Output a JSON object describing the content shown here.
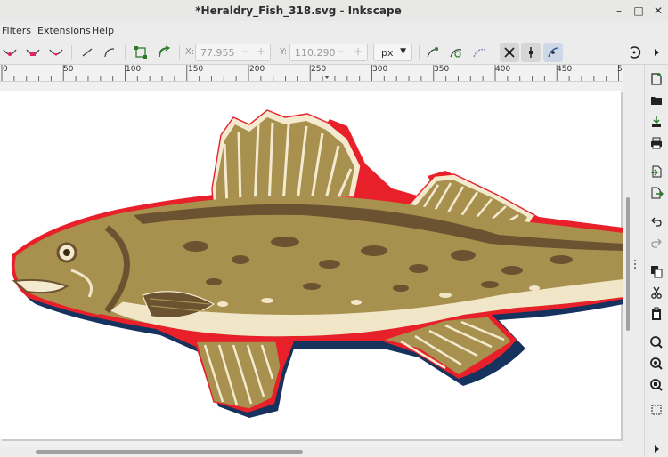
{
  "window": {
    "title": "*Heraldry_Fish_318.svg - Inkscape",
    "controls": [
      "minimize-icon",
      "maximize-icon",
      "close-icon"
    ]
  },
  "menu": {
    "items": [
      "Filters",
      "Extensions",
      "Help"
    ]
  },
  "toolbar": {
    "x_label": "X:",
    "x_value": "77.955",
    "y_label": "Y:",
    "y_value": "110.290",
    "minus": "−",
    "plus": "+",
    "unit": "px"
  },
  "ruler": {
    "labels": [
      "0",
      "50",
      "100",
      "150",
      "200",
      "250",
      "300",
      "350",
      "400",
      "450",
      "5"
    ]
  },
  "colors": {
    "fish_body": "#a8904e",
    "fish_dark": "#6b5230",
    "fish_cream": "#f1e6c8",
    "outline_red": "#e8202a",
    "outline_navy": "#15335e"
  },
  "canvas": {
    "artwork": "heraldry fish"
  }
}
